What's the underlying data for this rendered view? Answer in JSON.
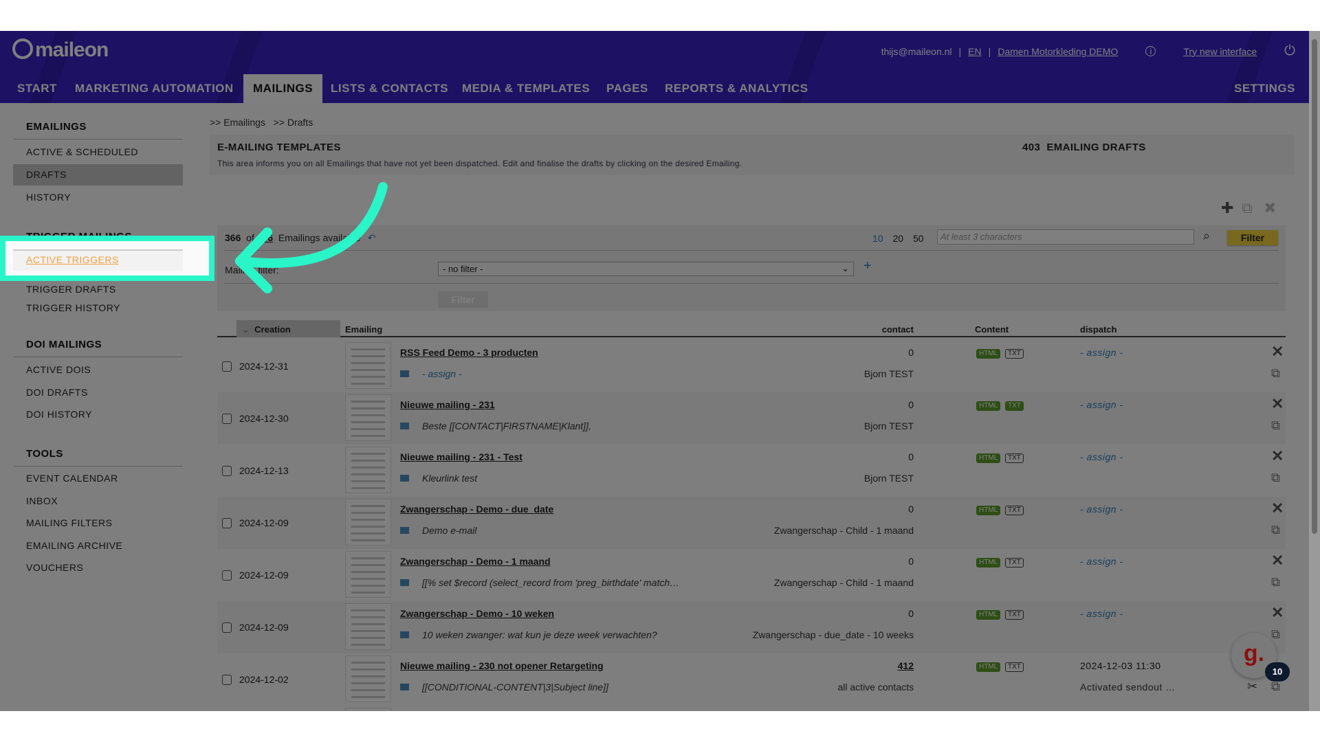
{
  "header": {
    "logo": "maileon",
    "user": "thijs@maileon.nl",
    "lang": "EN",
    "account": "Damen Motorkleding DEMO",
    "try_new": "Try new interface",
    "nav": [
      "START",
      "MARKETING AUTOMATION",
      "MAILINGS",
      "LISTS & CONTACTS",
      "MEDIA & TEMPLATES",
      "PAGES",
      "REPORTS & ANALYTICS"
    ],
    "settings": "SETTINGS"
  },
  "sidebar": {
    "sections": [
      {
        "title": "EMAILINGS",
        "items": [
          "ACTIVE & SCHEDULED",
          "DRAFTS",
          "HISTORY"
        ]
      },
      {
        "title": "TRIGGER MAILINGS",
        "items": [
          "ACTIVE TRIGGERS",
          "TRIGGER DRAFTS",
          "TRIGGER HISTORY"
        ]
      },
      {
        "title": "DOI MAILINGS",
        "items": [
          "ACTIVE DOIS",
          "DOI DRAFTS",
          "DOI HISTORY"
        ]
      },
      {
        "title": "TOOLS",
        "items": [
          "EVENT CALENDAR",
          "INBOX",
          "MAILING FILTERS",
          "EMAILING ARCHIVE",
          "VOUCHERS"
        ]
      }
    ],
    "selected": "DRAFTS",
    "highlighted": "ACTIVE TRIGGERS"
  },
  "breadcrumb": [
    ">> Emailings",
    ">> Drafts"
  ],
  "info": {
    "title": "E-MAILING TEMPLATES",
    "description": "This area informs you on all Emailings that have not yet been dispatched. Edit and finalise the drafts by clicking on the desired Emailing.",
    "count": "403",
    "count_label": "EMAILING DRAFTS"
  },
  "filter": {
    "shown": "366",
    "of": "of",
    "total": "366",
    "label": "Emailings available",
    "page_sizes": [
      "10",
      "20",
      "50"
    ],
    "active_page_size": "10",
    "search_placeholder": "At least 3 characters",
    "filter_button": "Filter",
    "mailing_filter_label": "Mailing filter:",
    "mailing_filter_value": "- no filter -",
    "apply_button": "Filter"
  },
  "table": {
    "headers": {
      "creation": "Creation",
      "emailing": "Emailing",
      "contact": "contact",
      "content": "Content",
      "dispatch": "dispatch"
    },
    "rows": [
      {
        "date": "2024-12-31",
        "title": "RSS Feed Demo - 3 producten",
        "subject": "- assign -",
        "subject_assign": true,
        "contacts": "0",
        "target": "Bjorn TEST",
        "html": true,
        "txt": false,
        "dispatch": "- assign -"
      },
      {
        "date": "2024-12-30",
        "title": "Nieuwe mailing - 231",
        "subject": "Beste [[CONTACT|FIRSTNAME|Klant]],",
        "contacts": "0",
        "target": "Bjorn TEST",
        "html": true,
        "txt": true,
        "dispatch": "- assign -"
      },
      {
        "date": "2024-12-13",
        "title": "Nieuwe mailing - 231 - Test",
        "subject": "Kleurlink test",
        "contacts": "0",
        "target": "Bjorn TEST",
        "html": true,
        "txt": false,
        "dispatch": "- assign -"
      },
      {
        "date": "2024-12-09",
        "title": "Zwangerschap - Demo - due_date",
        "subject": "Demo e-mail",
        "contacts": "0",
        "target": "Zwangerschap - Child - 1 maand",
        "html": true,
        "txt": false,
        "dispatch": "- assign -"
      },
      {
        "date": "2024-12-09",
        "title": "Zwangerschap - Demo - 1 maand",
        "subject": "[[% set $record (select_record from 'preg_birthdate' match…",
        "contacts": "0",
        "target": "Zwangerschap - Child - 1 maand",
        "html": true,
        "txt": false,
        "dispatch": "- assign -"
      },
      {
        "date": "2024-12-09",
        "title": "Zwangerschap - Demo - 10 weken",
        "subject": "10 weken zwanger: wat kun je deze week verwachten?",
        "contacts": "0",
        "target": "Zwangerschap - due_date - 10 weeks",
        "html": true,
        "txt": false,
        "dispatch": "- assign -"
      },
      {
        "date": "2024-12-02",
        "title": "Nieuwe mailing - 230 not opener Retargeting",
        "subject": "[[CONDITIONAL-CONTENT|3|Subject line]]",
        "contacts": "412",
        "target": "all active contacts",
        "html": true,
        "txt": false,
        "dispatch": "2024-12-03 11:30",
        "dispatch2": "Activated sendout …"
      }
    ],
    "badge_html": "HTML",
    "badge_txt": "TXT"
  },
  "widget": {
    "logo": "g.",
    "count": "10"
  },
  "colors": {
    "header": "#3a22c9",
    "highlight": "#2af5c8",
    "active_link": "#f0a040",
    "filter_button": "#f1d23e",
    "badge": "#5c9c2a"
  }
}
